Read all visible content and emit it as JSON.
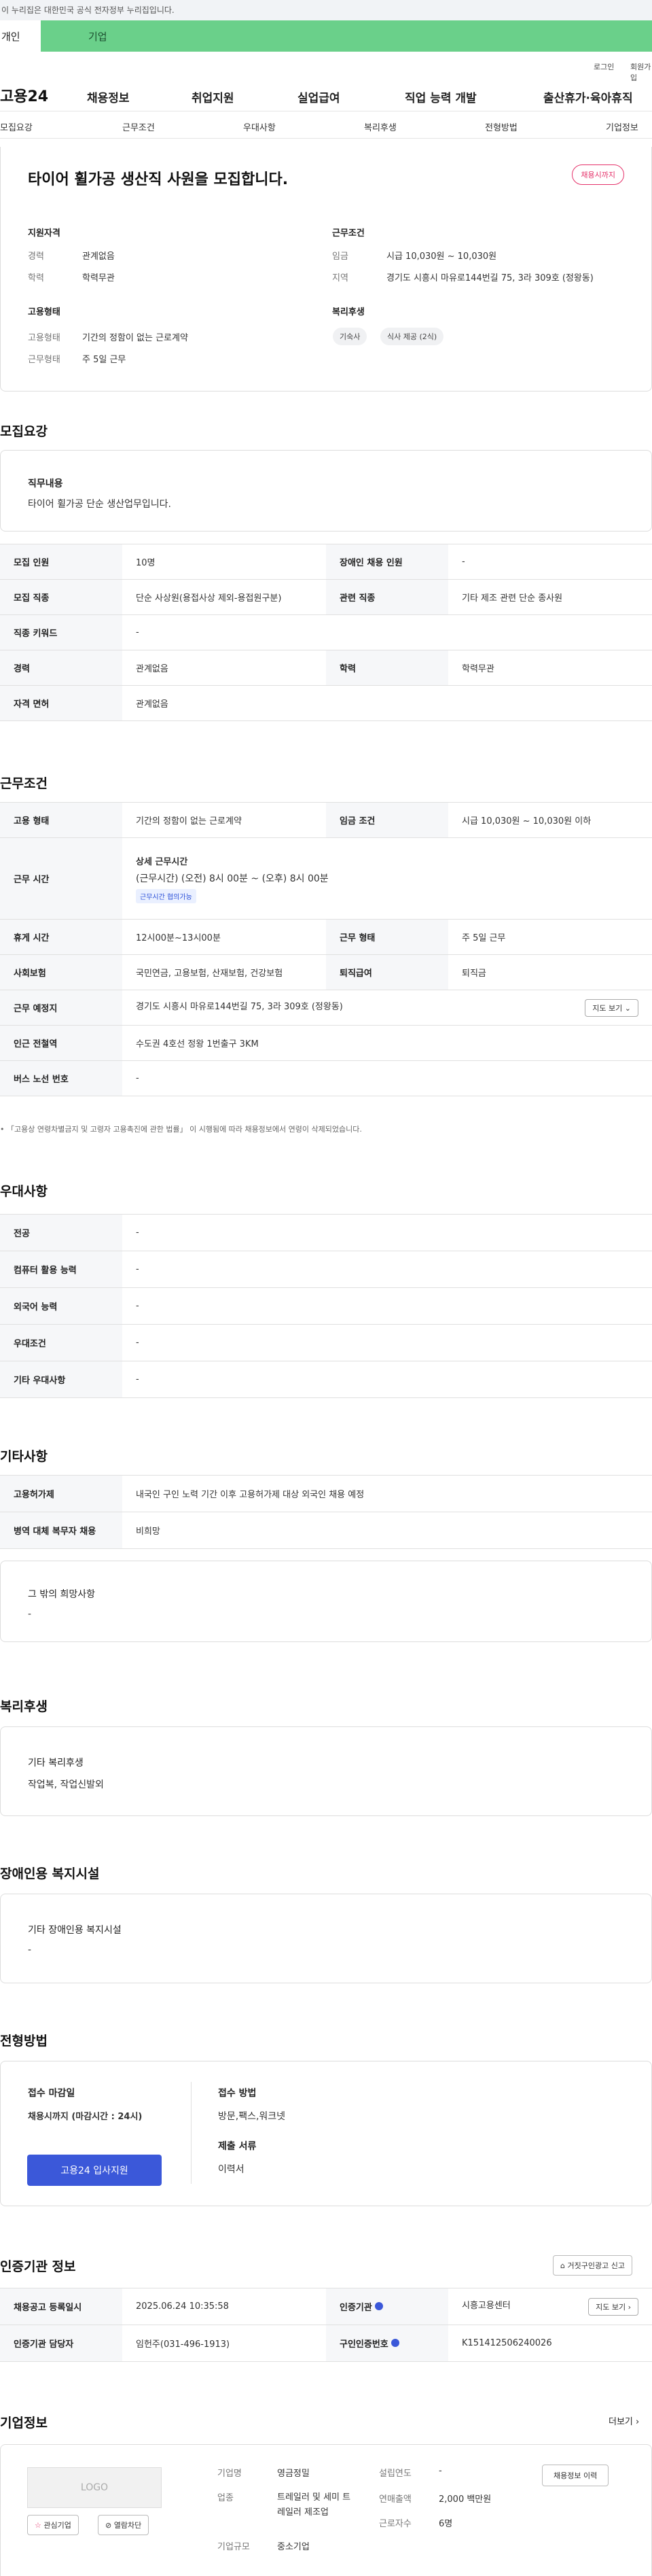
{
  "gov_bar": "이 누리집은 대한민국 공식 전자정부 누리집입니다.",
  "tabs": {
    "personal": "개인",
    "company": "기업"
  },
  "util": {
    "login": "로그인",
    "signup": "회원가입"
  },
  "logo": "고용24",
  "gnb": [
    "채용정보",
    "취업지원",
    "실업급여",
    "직업 능력 개발",
    "출산휴가·육아휴직"
  ],
  "anchor_nav": [
    "모집요강",
    "근무조건",
    "우대사항",
    "복리후생",
    "전형방법",
    "기업정보"
  ],
  "hero": {
    "title": "타이어 휠가공 생산직 사원을 모집합니다.",
    "status": "채용시까지",
    "qual_title": "지원자격",
    "career_label": "경력",
    "career_val": "관계없음",
    "edu_label": "학력",
    "edu_val": "학력무관",
    "emp_title": "고용형태",
    "emp_label": "고용형태",
    "emp_val": "기간의 정함이 없는 근로계약",
    "work_label": "근무형태",
    "work_val": "주 5일 근무",
    "cond_title": "근무조건",
    "wage_label": "임금",
    "wage_val": "시급 10,030원 ~ 10,030원",
    "area_label": "지역",
    "area_val": "경기도 시흥시 마유로144번길 75, 3라 309호 (정왕동)",
    "welfare_title": "복리후생",
    "chips": [
      "기숙사",
      "식사 제공 (2식)"
    ]
  },
  "recruit": {
    "section": "모집요강",
    "duty_title": "직무내용",
    "duty_text": "타이어 휠가공 단순 생산업무입니다.",
    "rows": [
      {
        "k1": "모집 인원",
        "v1": "10명",
        "k2": "장애인 채용 인원",
        "v2": "-"
      },
      {
        "k1": "모집 직종",
        "v1": "단순 사상원(용접사상 제외-용접원구분)",
        "k2": "관련 직종",
        "v2": "기타 제조 관련 단순 종사원"
      },
      {
        "k1": "직종 키워드",
        "v1": "-"
      },
      {
        "k1": "경력",
        "v1": "관계없음",
        "k2": "학력",
        "v2": "학력무관"
      },
      {
        "k1": "자격 면허",
        "v1": "관계없음"
      }
    ]
  },
  "conditions": {
    "section": "근무조건",
    "emp_type_label": "고용 형태",
    "emp_type_val": "기간의 정함이 없는 근로계약",
    "wage_label": "임금 조건",
    "wage_val": "시급 10,030원 ~ 10,030원 이하",
    "hours_label": "근무 시간",
    "hours_title": "상세 근무시간",
    "hours_val": "(근무시간) (오전) 8시 00분 ~ (오후) 8시 00분",
    "hours_badge": "근무시간 협의가능",
    "break_label": "휴게 시간",
    "break_val": "12시00분~13시00분",
    "form_label": "근무 형태",
    "form_val": "주 5일 근무",
    "insurance_label": "사회보험",
    "insurance_val": "국민연금, 고용보험, 산재보험, 건강보험",
    "retire_label": "퇴직급여",
    "retire_val": "퇴직금",
    "place_label": "근무 예정지",
    "place_val": "경기도 시흥시 마유로144번길 75, 3라 309호 (정왕동)",
    "map_btn": "지도 보기",
    "station_label": "인근 전철역",
    "station_val": "수도권 4호선 정왕 1번출구 3KM",
    "bus_label": "버스 노선 번호",
    "bus_val": "-",
    "note": "「고용상 연령차별금지 및 고령자 고용촉진에 관한 법률」 이 시행됨에 따라 채용정보에서 연령이 삭제되었습니다."
  },
  "preference": {
    "section": "우대사항",
    "rows": [
      {
        "k": "전공",
        "v": "-"
      },
      {
        "k": "컴퓨터 활용 능력",
        "v": "-"
      },
      {
        "k": "외국어 능력",
        "v": "-"
      },
      {
        "k": "우대조건",
        "v": "-"
      },
      {
        "k": "기타 우대사항",
        "v": "-"
      }
    ]
  },
  "etc": {
    "section": "기타사항",
    "foreign_label": "고용허가제",
    "foreign_val": "내국인 구인 노력 기간 이후 고용허가제 대상 외국인 채용 예정",
    "military_label": "병역 대체 복무자 채용",
    "military_val": "비희망",
    "other_title": "그 밖의 희망사항",
    "other_val": "-"
  },
  "welfare": {
    "section": "복리후생",
    "title": "기타 복리후생",
    "text": "작업복, 작업신발외"
  },
  "disability": {
    "section": "장애인용 복지시설",
    "title": "기타 장애인용 복지시설",
    "text": "-"
  },
  "selection": {
    "section": "전형방법",
    "deadline_title": "접수 마감일",
    "deadline_val": "채용시까지 (마감시간 : 24시)",
    "apply_btn": "고용24 입사지원",
    "method_title": "접수 방법",
    "method_val": "방문,팩스,워크넷",
    "docs_title": "제출 서류",
    "docs_val": "이력서"
  },
  "agency": {
    "section": "인증기관 정보",
    "report_btn": "거짓구인광고 신고",
    "reg_label": "채용공고 등록일시",
    "reg_val": "2025.06.24 10:35:58",
    "agency_label": "인증기관",
    "agency_val": "시흥고용센터",
    "map_btn": "지도 보기",
    "staff_label": "인증기관 담당자",
    "staff_val": "임헌주(031-496-1913)",
    "cert_label": "구인인증번호",
    "cert_val": "K151412506240026"
  },
  "company": {
    "section": "기업정보",
    "more": "더보기",
    "logo_text": "LOGO",
    "interest_btn": "관심기업",
    "block_btn": "열람차단",
    "name_label": "기업명",
    "name_val": "영금정밀",
    "industry_label": "업종",
    "industry_val": "트레일러 및 세미 트레일러 제조업",
    "size_label": "기업규모",
    "size_val": "중소기업",
    "founded_label": "설립연도",
    "founded_val": "-",
    "sales_label": "연매출액",
    "sales_val": "2,000 백만원",
    "staff_label": "근로자수",
    "staff_val": "6명",
    "history_btn": "채용정보 이력"
  },
  "colors": {
    "accent_green": "#6ad08a",
    "accent_blue": "#3b58d9",
    "accent_red": "#e5336b"
  }
}
